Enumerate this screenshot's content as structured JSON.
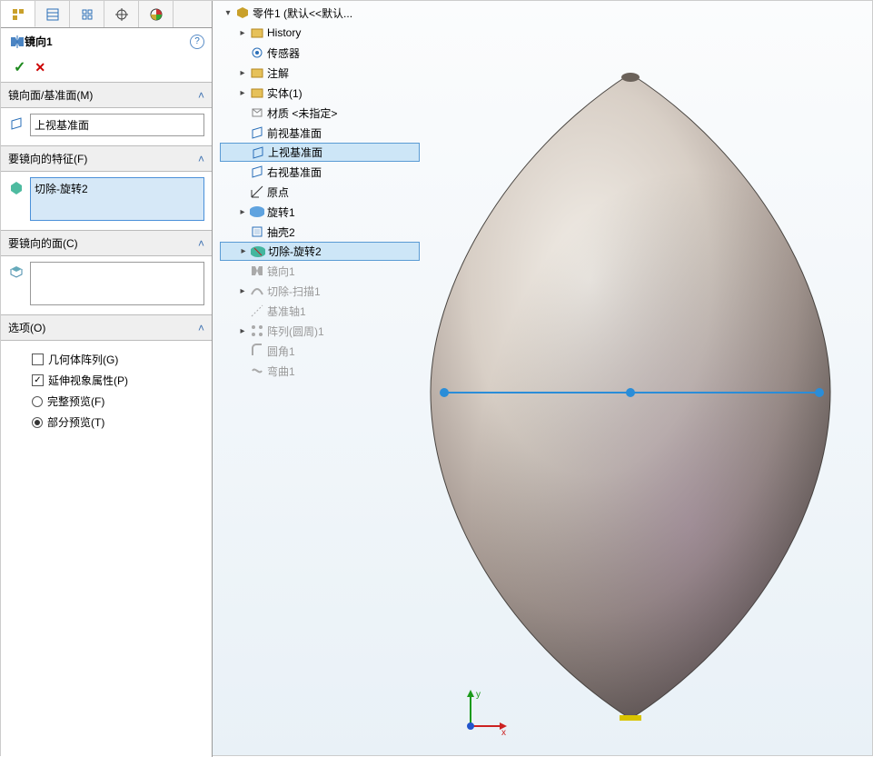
{
  "feature": {
    "title": "镜向1",
    "sections": {
      "mirror_plane": {
        "label": "镜向面/基准面(M)",
        "value": "上视基准面"
      },
      "features": {
        "label": "要镜向的特征(F)",
        "value": "切除-旋转2"
      },
      "faces": {
        "label": "要镜向的面(C)",
        "value": ""
      },
      "options": {
        "label": "选项(O)",
        "geo_pattern": {
          "label": "几何体阵列(G)",
          "checked": false
        },
        "prop_visual": {
          "label": "延伸视象属性(P)",
          "checked": true
        },
        "full_preview": {
          "label": "完整预览(F)",
          "selected": false
        },
        "part_preview": {
          "label": "部分预览(T)",
          "selected": true
        }
      }
    }
  },
  "tree": {
    "root": "零件1  (默认<<默认...",
    "items": [
      {
        "label": "History",
        "icon": "folder",
        "exp": true
      },
      {
        "label": "传感器",
        "icon": "sensor"
      },
      {
        "label": "注解",
        "icon": "folder",
        "exp": true
      },
      {
        "label": "实体(1)",
        "icon": "folder",
        "exp": true
      },
      {
        "label": "材质 <未指定>",
        "icon": "material"
      },
      {
        "label": "前视基准面",
        "icon": "plane"
      },
      {
        "label": "上视基准面",
        "icon": "plane",
        "sel": true
      },
      {
        "label": "右视基准面",
        "icon": "plane"
      },
      {
        "label": "原点",
        "icon": "origin"
      },
      {
        "label": "旋转1",
        "icon": "revolve",
        "exp": true
      },
      {
        "label": "抽壳2",
        "icon": "shell"
      },
      {
        "label": "切除-旋转2",
        "icon": "cutrev",
        "exp": true,
        "sel": true
      },
      {
        "label": "镜向1",
        "icon": "mirror",
        "dim": true
      },
      {
        "label": "切除-扫描1",
        "icon": "cutsweep",
        "exp": true,
        "dim": true
      },
      {
        "label": "基准轴1",
        "icon": "axis",
        "dim": true
      },
      {
        "label": "阵列(圆周)1",
        "icon": "pattern",
        "exp": true,
        "dim": true
      },
      {
        "label": "圆角1",
        "icon": "fillet",
        "dim": true
      },
      {
        "label": "弯曲1",
        "icon": "flex",
        "dim": true
      }
    ]
  },
  "triad": {
    "x": "x",
    "y": "y"
  }
}
